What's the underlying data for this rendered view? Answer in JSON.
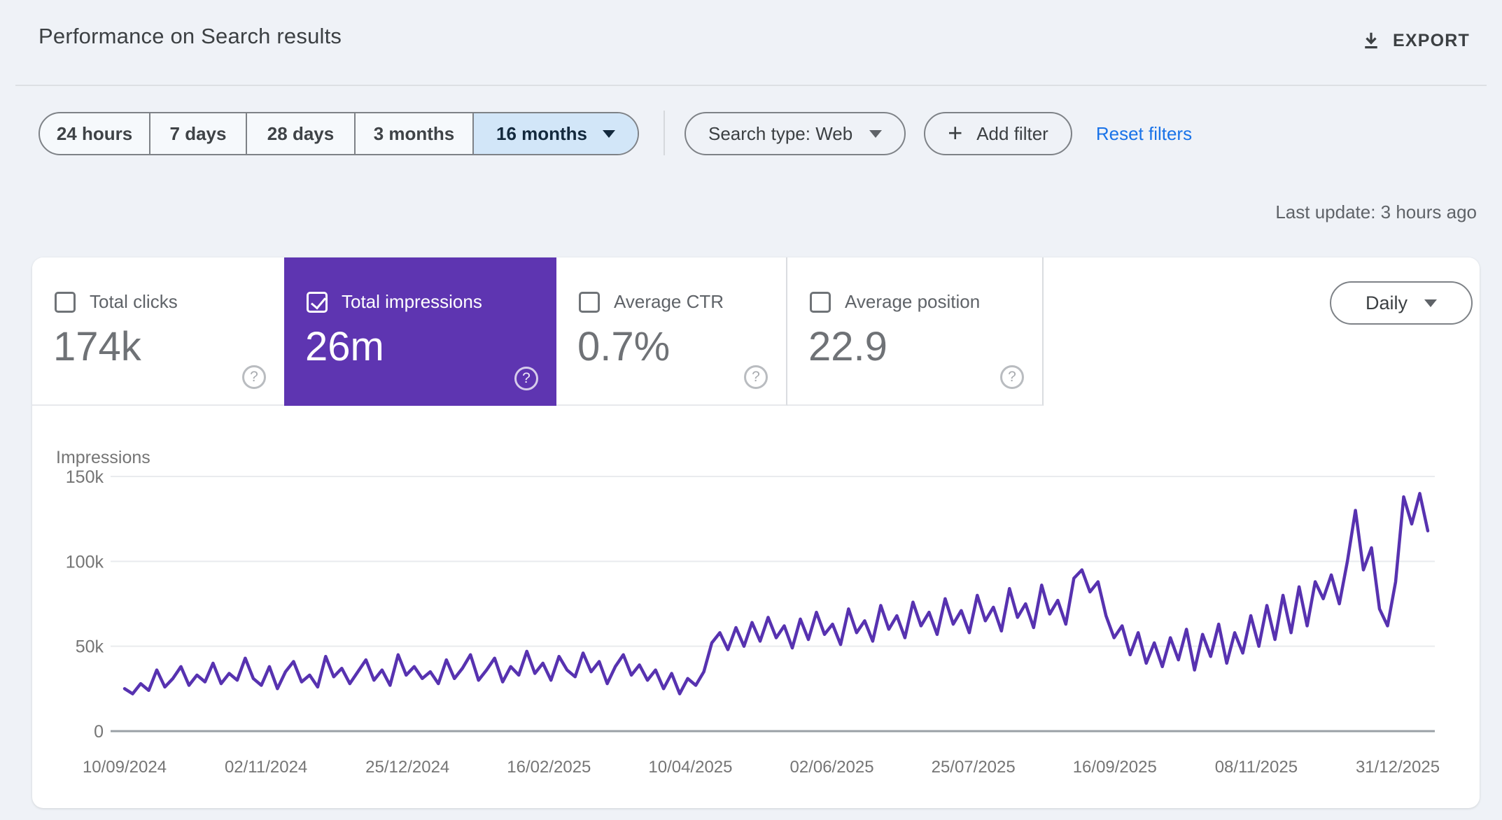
{
  "header": {
    "title": "Performance on Search results",
    "export_label": "EXPORT"
  },
  "toolbar": {
    "date_ranges": [
      "24 hours",
      "7 days",
      "28 days",
      "3 months",
      "16 months"
    ],
    "selected_range": "16 months",
    "search_type_label": "Search type: Web",
    "add_filter_label": "Add filter",
    "reset_filters_label": "Reset filters"
  },
  "status": {
    "last_update": "Last update: 3 hours ago"
  },
  "metrics": [
    {
      "label": "Total clicks",
      "value": "174k",
      "checked": false,
      "selected": false
    },
    {
      "label": "Total impressions",
      "value": "26m",
      "checked": true,
      "selected": true
    },
    {
      "label": "Average CTR",
      "value": "0.7%",
      "checked": false,
      "selected": false
    },
    {
      "label": "Average position",
      "value": "22.9",
      "checked": false,
      "selected": false
    }
  ],
  "granularity": {
    "label": "Daily"
  },
  "colors": {
    "accent_blue": "#1a73e8",
    "selected_metric_purple": "#5e35b1",
    "selected_chip_bg": "#d2e6f8",
    "page_bg": "#eff2f7"
  },
  "chart_data": {
    "type": "line",
    "title": "Impressions",
    "series_name": "Total impressions",
    "line_color": "#5732b0",
    "ylim": [
      0,
      150
    ],
    "y_unit": "thousands of impressions",
    "grid": "horizontal-only",
    "y_ticks": [
      {
        "label": "0",
        "value": 0
      },
      {
        "label": "50k",
        "value": 50
      },
      {
        "label": "100k",
        "value": 100
      },
      {
        "label": "150k",
        "value": 150
      }
    ],
    "x_tick_labels": [
      "10/09/2024",
      "02/11/2024",
      "25/12/2024",
      "16/02/2025",
      "10/04/2025",
      "02/06/2025",
      "25/07/2025",
      "16/09/2025",
      "08/11/2025",
      "31/12/2025"
    ],
    "x_start_date": "10/09/2024",
    "sampling_interval_days": 3,
    "values_thousands": [
      25,
      22,
      28,
      24,
      36,
      26,
      31,
      38,
      27,
      33,
      29,
      40,
      28,
      34,
      30,
      43,
      31,
      27,
      38,
      25,
      35,
      41,
      29,
      33,
      26,
      44,
      32,
      37,
      28,
      35,
      42,
      30,
      36,
      27,
      45,
      33,
      38,
      31,
      35,
      28,
      42,
      31,
      37,
      45,
      30,
      36,
      43,
      29,
      38,
      33,
      47,
      34,
      40,
      30,
      44,
      36,
      32,
      46,
      35,
      41,
      28,
      38,
      45,
      33,
      39,
      30,
      36,
      25,
      34,
      22,
      31,
      27,
      35,
      52,
      58,
      48,
      61,
      50,
      64,
      53,
      67,
      55,
      62,
      49,
      66,
      54,
      70,
      57,
      63,
      51,
      72,
      58,
      65,
      53,
      74,
      60,
      68,
      55,
      76,
      62,
      70,
      57,
      78,
      63,
      71,
      58,
      80,
      65,
      73,
      59,
      84,
      67,
      75,
      61,
      86,
      69,
      77,
      63,
      90,
      95,
      82,
      88,
      68,
      55,
      62,
      45,
      58,
      40,
      52,
      38,
      55,
      42,
      60,
      36,
      57,
      44,
      63,
      40,
      58,
      46,
      68,
      50,
      74,
      54,
      80,
      58,
      85,
      62,
      88,
      78,
      92,
      75,
      100,
      130,
      95,
      108,
      72,
      62,
      88,
      138,
      122,
      140,
      118
    ]
  }
}
